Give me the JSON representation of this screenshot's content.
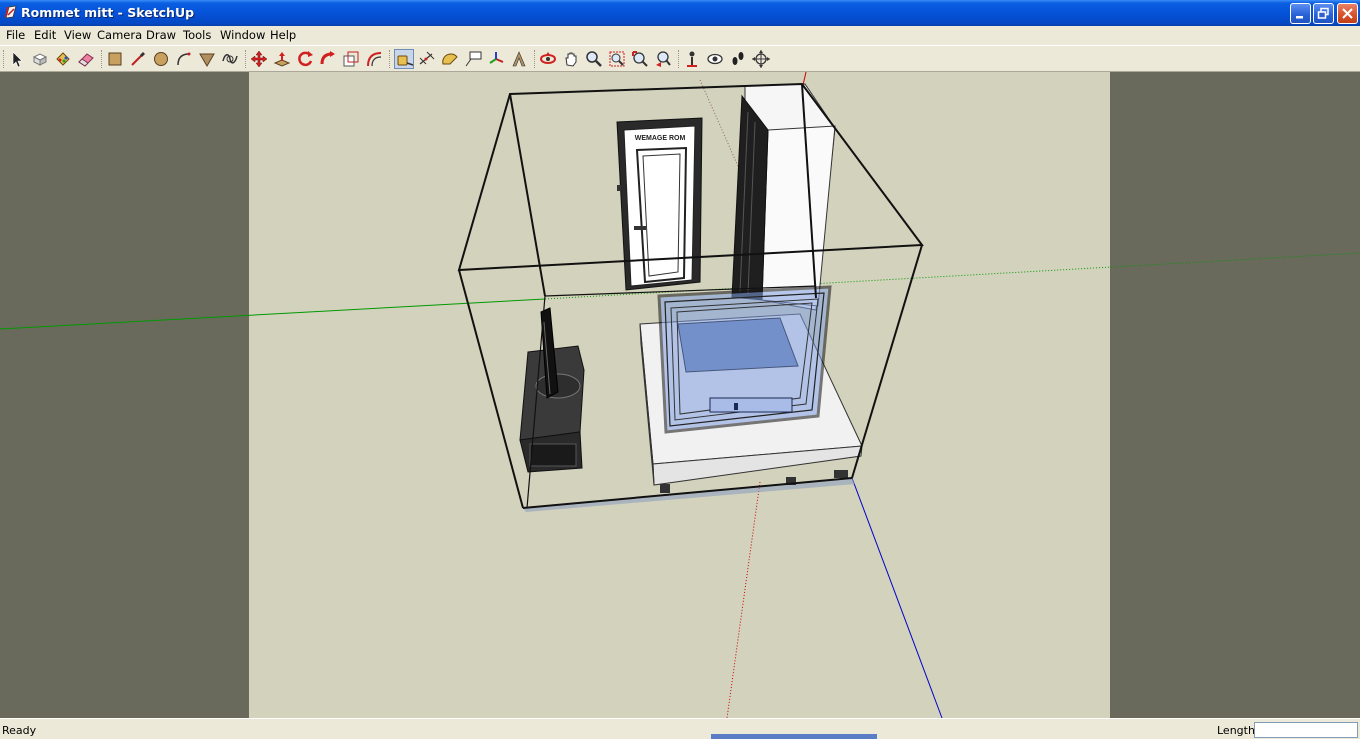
{
  "window": {
    "title": "Rommet mitt - SketchUp"
  },
  "menu": {
    "items": [
      "File",
      "Edit",
      "View",
      "Camera",
      "Draw",
      "Tools",
      "Window",
      "Help"
    ]
  },
  "toolbar": {
    "tools": [
      "select-icon",
      "make-component-icon",
      "paint-bucket-icon",
      "eraser-icon",
      "rectangle-icon",
      "line-icon",
      "circle-icon",
      "arc-icon",
      "polygon-icon",
      "freehand-icon",
      "move-icon",
      "push-pull-icon",
      "rotate-icon",
      "follow-me-icon",
      "scale-icon",
      "offset-icon",
      "tape-measure-icon",
      "dimension-icon",
      "protractor-icon",
      "text-icon",
      "axes-icon",
      "3d-text-icon",
      "orbit-icon",
      "pan-icon",
      "zoom-icon",
      "zoom-window-icon",
      "zoom-extents-icon",
      "previous-view-icon",
      "position-camera-icon",
      "look-around-icon",
      "walk-icon",
      "section-plane-icon"
    ],
    "active_tool": "tape-measure-icon"
  },
  "colors": {
    "titlebar": "#0552D8",
    "ground": "#D3D2BD",
    "viewport_background": "#6A6A5C",
    "red_axis": "#CC0000",
    "green_axis": "#009900",
    "blue_axis": "#0000CC",
    "glass": "#7F9FE0"
  },
  "model": {
    "door_sign": "WEMAGE ROM"
  },
  "status": {
    "text": "Ready",
    "measurement_label": "Length",
    "measurement_value": ""
  }
}
